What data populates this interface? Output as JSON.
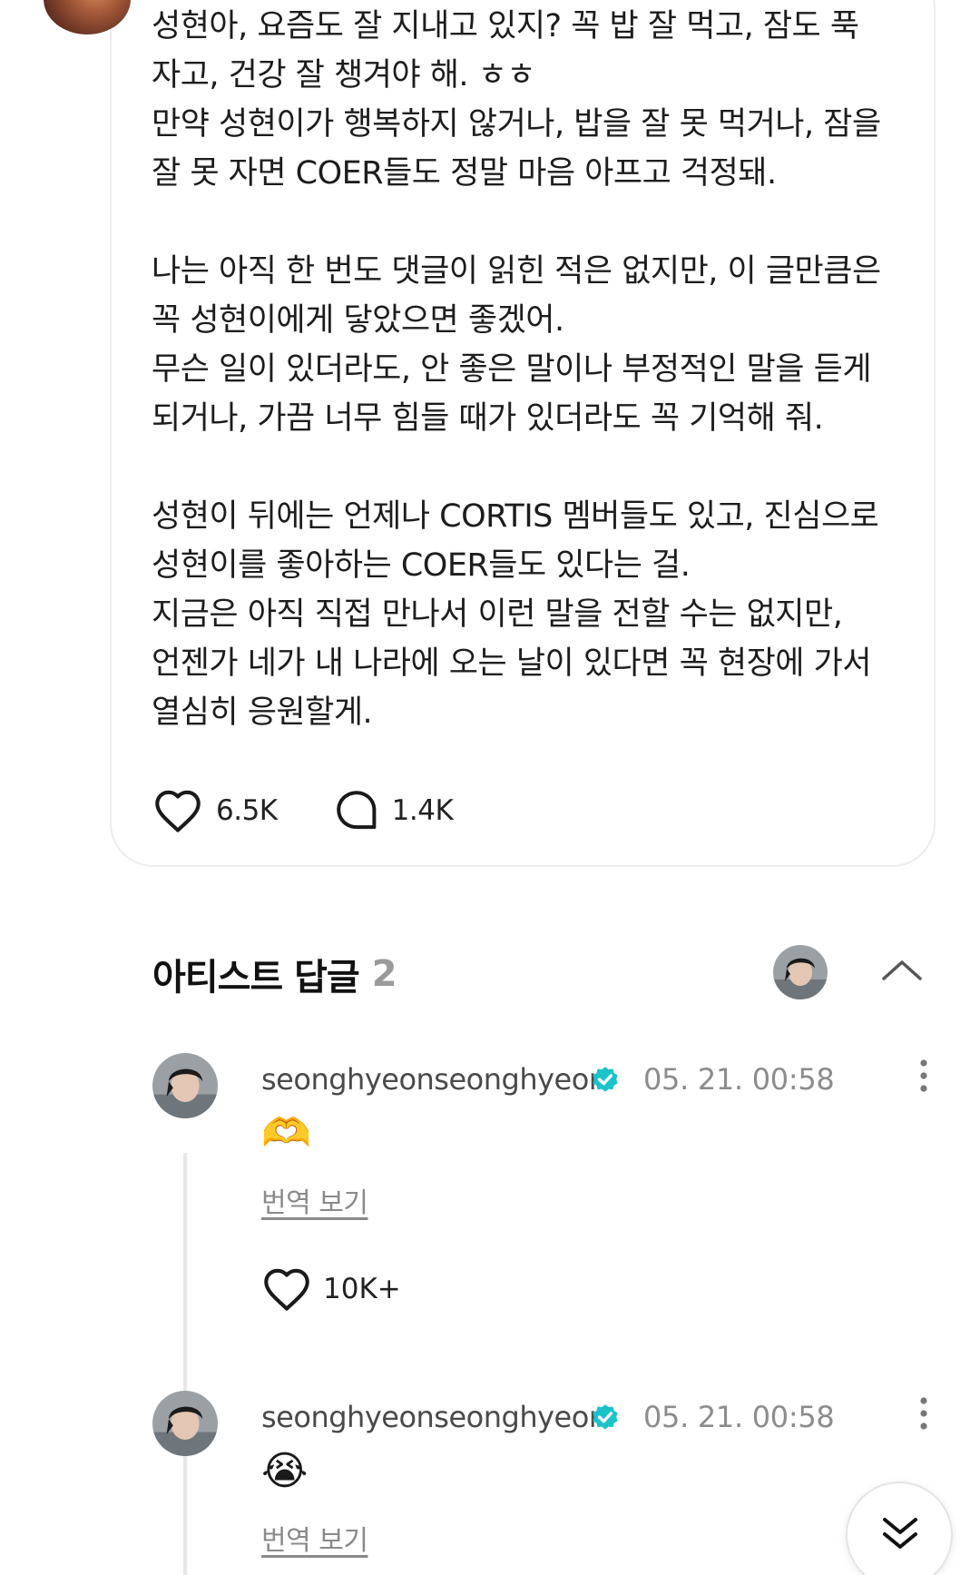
{
  "post": {
    "paragraphs": [
      [
        "성현아, 요즘도 잘 지내고 있지? 꼭 밥 잘 먹고, 잠도 푹",
        "자고, 건강 잘 챙겨야 해. ㅎㅎ",
        "만약 성현이가 행복하지 않거나, 밥을 잘 못 먹거나, 잠을",
        "잘 못 자면 COER들도 정말 마음 아프고 걱정돼."
      ],
      [
        "나는 아직 한 번도 댓글이 읽힌 적은 없지만, 이 글만큼은",
        "꼭 성현이에게 닿았으면 좋겠어.",
        "무슨 일이 있더라도, 안 좋은 말이나 부정적인 말을 듣게",
        "되거나, 가끔 너무 힘들 때가 있더라도 꼭 기억해 줘."
      ],
      [
        "성현이 뒤에는 언제나 CORTIS 멤버들도 있고, 진심으로",
        "성현이를 좋아하는 COER들도 있다는 걸.",
        "지금은 아직 직접 만나서 이런 말을 전할 수는 없지만,",
        "언젠가 네가 내 나라에 오는 날이 있다면 꼭 현장에 가서",
        "열심히 응원할게."
      ]
    ],
    "like_count": "6.5K",
    "comment_count": "1.4K"
  },
  "replies_section": {
    "title": "아티스트 답글",
    "count": "2"
  },
  "replies": [
    {
      "username": "seonghyeonseonghyeon",
      "time": "05. 21. 00:58",
      "emoji": "🫶",
      "translate_label": "번역 보기",
      "like_count": "10K+"
    },
    {
      "username": "seonghyeonseonghyeon",
      "time": "05. 21. 00:58",
      "emoji": "😭",
      "translate_label": "번역 보기"
    }
  ],
  "icons": {
    "like": "heart-outline-icon",
    "comment": "speech-bubble-icon",
    "verified": "verified-badge-icon",
    "collapse": "chevron-up-icon",
    "more": "more-vertical-icon",
    "scroll": "double-chevron-down-icon"
  },
  "colors": {
    "verified": "#19c3c9",
    "muted_text": "#8c8c8c",
    "card_border": "#ececec"
  }
}
